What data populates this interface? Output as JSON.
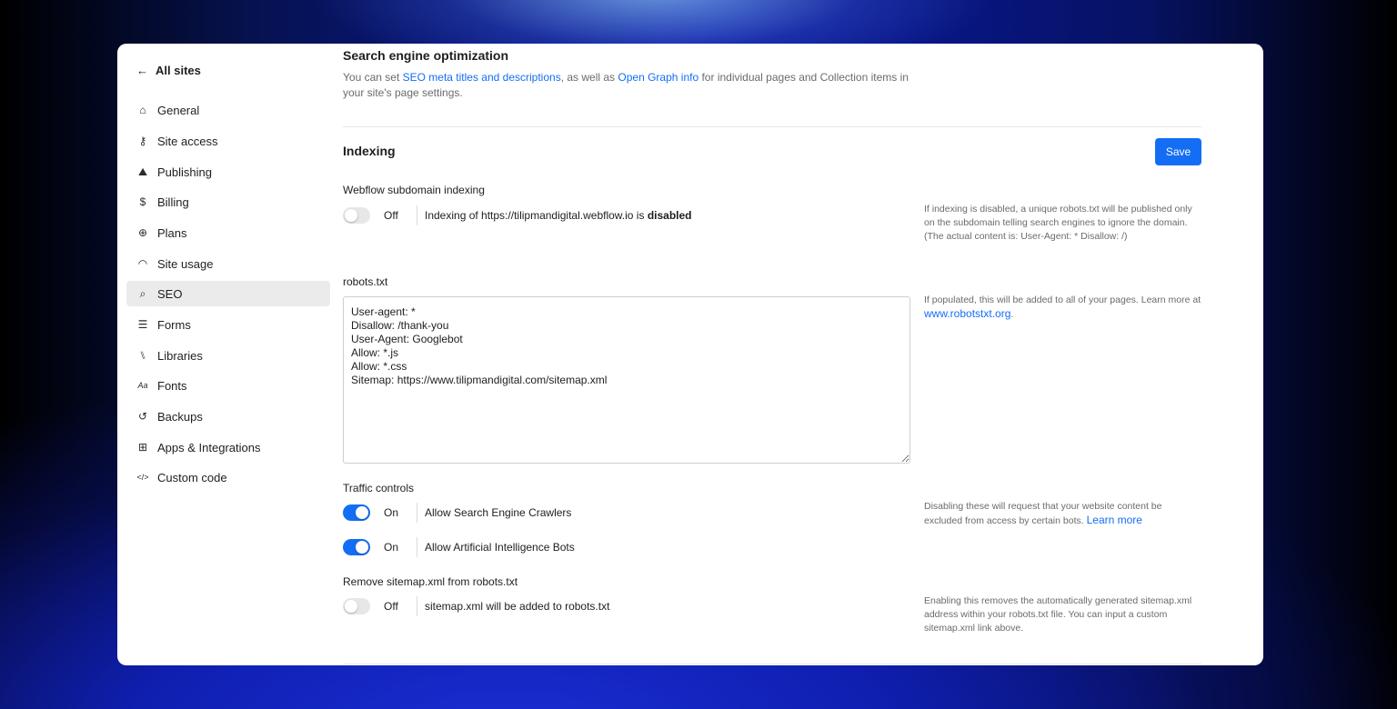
{
  "sidebar": {
    "back_label": "All sites",
    "items": [
      {
        "label": "General",
        "icon": "⌂"
      },
      {
        "label": "Site access",
        "icon": "⚷"
      },
      {
        "label": "Publishing",
        "icon": "⛰"
      },
      {
        "label": "Billing",
        "icon": "$"
      },
      {
        "label": "Plans",
        "icon": "⊕"
      },
      {
        "label": "Site usage",
        "icon": "◠"
      },
      {
        "label": "SEO",
        "icon": "⌕"
      },
      {
        "label": "Forms",
        "icon": "☰"
      },
      {
        "label": "Libraries",
        "icon": "⑊"
      },
      {
        "label": "Fonts",
        "icon": "Aa"
      },
      {
        "label": "Backups",
        "icon": "↺"
      },
      {
        "label": "Apps & Integrations",
        "icon": "⊞"
      },
      {
        "label": "Custom code",
        "icon": "</>"
      }
    ],
    "active": "SEO"
  },
  "seo": {
    "title": "Search engine optimization",
    "desc_prefix": "You can set ",
    "link1": "SEO meta titles and descriptions",
    "desc_mid": ", as well as ",
    "link2": "Open Graph info",
    "desc_suffix": " for individual pages and Collection items in your site's page settings."
  },
  "indexing": {
    "title": "Indexing",
    "save_label": "Save",
    "subdomain": {
      "label": "Webflow subdomain indexing",
      "state": "Off",
      "text_prefix": "Indexing of https://tilipmandigital.webflow.io is ",
      "text_bold": "disabled",
      "help": "If indexing is disabled, a unique robots.txt will be published only on the subdomain telling search engines to ignore the domain. (The actual content is: User-Agent: * Disallow: /)"
    },
    "robots": {
      "label": "robots.txt",
      "content": "User-agent: *\nDisallow: /thank-you\nUser-Agent: Googlebot\nAllow: *.js\nAllow: *.css\nSitemap: https://www.tilipmandigital.com/sitemap.xml",
      "help_prefix": "If populated, this will be added to all of your pages. Learn more at ",
      "help_link": "www.robotstxt.org",
      "help_suffix": "."
    },
    "traffic": {
      "label": "Traffic controls",
      "crawlers": {
        "state": "On",
        "text": "Allow Search Engine Crawlers"
      },
      "ai_bots": {
        "state": "On",
        "text": "Allow Artificial Intelligence Bots"
      },
      "help_prefix": "Disabling these will request that your website content be excluded from access by certain bots. ",
      "help_link": "Learn more"
    },
    "sitemap": {
      "label": "Remove sitemap.xml from robots.txt",
      "state": "Off",
      "text": "sitemap.xml will be added to robots.txt",
      "help": "Enabling this removes the automatically generated sitemap.xml address within your robots.txt file. You can input a custom sitemap.xml link above."
    }
  },
  "colors": {
    "accent": "#146ef5",
    "active_nav": "#ebebeb"
  }
}
